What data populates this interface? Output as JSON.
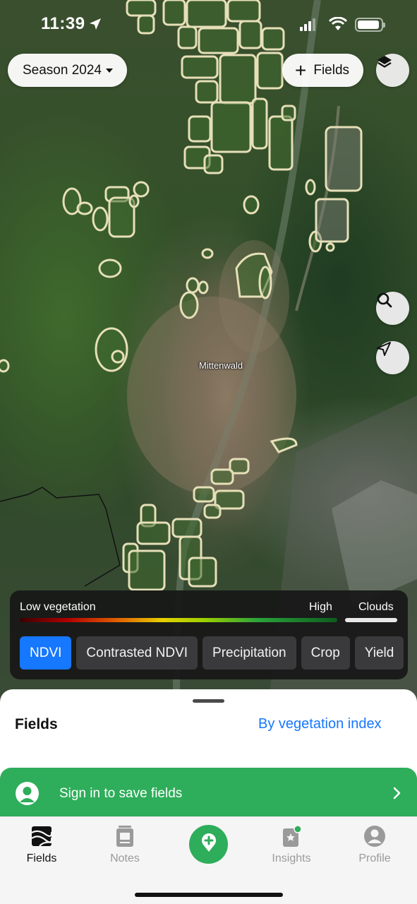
{
  "status_bar": {
    "time": "11:39"
  },
  "map": {
    "town_label": "Mittenwald",
    "season_button": "Season 2024",
    "fields_button": "Fields"
  },
  "legend": {
    "low_label": "Low vegetation",
    "high_label": "High",
    "clouds_label": "Clouds",
    "chips": [
      {
        "label": "NDVI",
        "active": true
      },
      {
        "label": "Contrasted NDVI",
        "active": false
      },
      {
        "label": "Precipitation",
        "active": false
      },
      {
        "label": "Crop",
        "active": false
      },
      {
        "label": "Yield",
        "active": false
      }
    ]
  },
  "sheet": {
    "title": "Fields",
    "sort_link": "By vegetation index"
  },
  "signin_banner": {
    "label": "Sign in to save fields"
  },
  "tab_bar": {
    "fields": "Fields",
    "notes": "Notes",
    "insights": "Insights",
    "profile": "Profile"
  },
  "colors": {
    "accent_blue": "#1677ff",
    "accent_green": "#2ead5a",
    "field_outline": "#e6dfb8"
  }
}
